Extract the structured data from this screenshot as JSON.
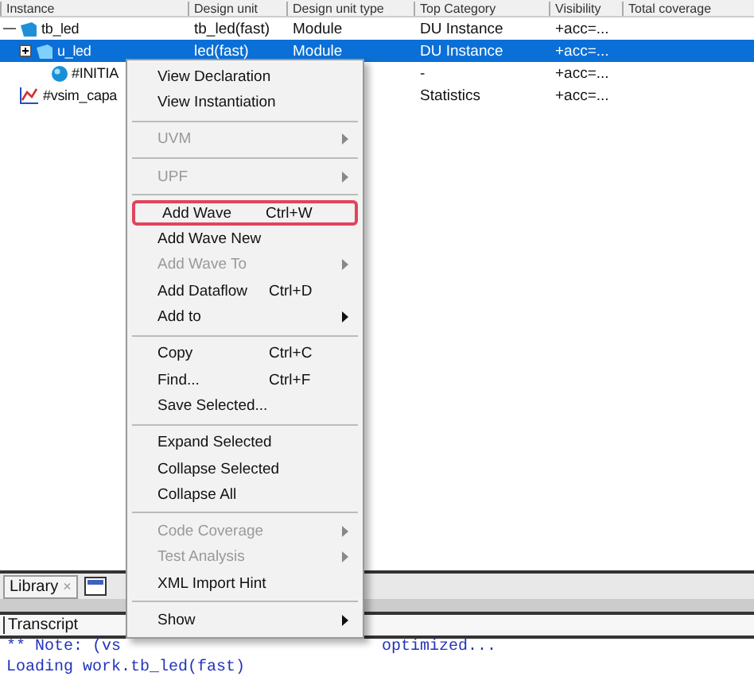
{
  "table": {
    "columns": [
      "Instance",
      "Design unit",
      "Design unit type",
      "Top Category",
      "Visibility",
      "Total coverage"
    ],
    "rows": [
      {
        "kind": "module",
        "cells": [
          "tb_led",
          "tb_led(fast)",
          "Module",
          "DU Instance",
          "+acc=..."
        ],
        "selected": false,
        "expanded": true,
        "children": [
          {
            "kind": "module",
            "cells": [
              "u_led",
              "led(fast)",
              "Module",
              "DU Instance",
              "+acc=..."
            ],
            "selected": true,
            "expanded": false,
            "children": [
              {
                "kind": "process",
                "cells": [
                  "#INITIA",
                  "",
                  "",
                  "-",
                  "+acc=..."
                ],
                "selected": false
              }
            ]
          }
        ]
      },
      {
        "kind": "stats",
        "cells": [
          "#vsim_capa",
          "",
          "",
          "Statistics",
          "+acc=..."
        ],
        "selected": false
      }
    ]
  },
  "context_menu": [
    {
      "kind": "item",
      "label": "View Declaration",
      "disabled": false
    },
    {
      "kind": "item",
      "label": "View Instantiation",
      "disabled": false
    },
    {
      "kind": "separator"
    },
    {
      "kind": "item",
      "label": "UVM",
      "disabled": true,
      "submenu": true
    },
    {
      "kind": "separator"
    },
    {
      "kind": "item",
      "label": "UPF",
      "disabled": true,
      "submenu": true
    },
    {
      "kind": "separator"
    },
    {
      "kind": "item",
      "label": "Add Wave",
      "shortcut": "Ctrl+W",
      "disabled": false,
      "highlighted": true
    },
    {
      "kind": "item",
      "label": "Add Wave New",
      "disabled": false
    },
    {
      "kind": "item",
      "label": "Add Wave To",
      "disabled": true,
      "submenu": true
    },
    {
      "kind": "item",
      "label": "Add Dataflow",
      "shortcut": "Ctrl+D",
      "disabled": false
    },
    {
      "kind": "item",
      "label": "Add to",
      "disabled": false,
      "submenu": true
    },
    {
      "kind": "separator"
    },
    {
      "kind": "item",
      "label": "Copy",
      "shortcut": "Ctrl+C",
      "disabled": false
    },
    {
      "kind": "item",
      "label": "Find...",
      "shortcut": "Ctrl+F",
      "disabled": false
    },
    {
      "kind": "item",
      "label": "Save Selected...",
      "disabled": false
    },
    {
      "kind": "separator"
    },
    {
      "kind": "item",
      "label": "Expand Selected",
      "disabled": false
    },
    {
      "kind": "item",
      "label": "Collapse Selected",
      "disabled": false
    },
    {
      "kind": "item",
      "label": "Collapse All",
      "disabled": false
    },
    {
      "kind": "separator"
    },
    {
      "kind": "item",
      "label": "Code Coverage",
      "disabled": true,
      "submenu": true
    },
    {
      "kind": "item",
      "label": "Test Analysis",
      "disabled": true,
      "submenu": true
    },
    {
      "kind": "item",
      "label": "XML Import Hint",
      "disabled": false
    },
    {
      "kind": "separator"
    },
    {
      "kind": "item",
      "label": "Show",
      "disabled": false,
      "submenu": true
    }
  ],
  "tabs": [
    {
      "label": "Library",
      "close": "×"
    }
  ],
  "transcript": {
    "title": "Transcript",
    "lines": [
      {
        "left": "** Note: (vs",
        "right": "optimized..."
      },
      {
        "left": "Loading work.tb_led(fast)"
      }
    ]
  }
}
